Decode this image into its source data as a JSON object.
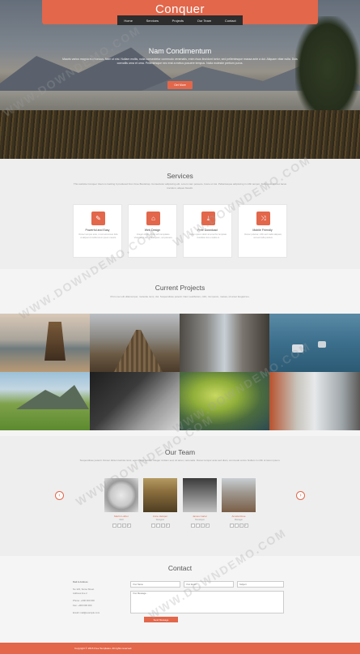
{
  "brand": "Conquer",
  "nav": [
    "Home",
    "Services",
    "Projects",
    "Our Team",
    "Contact"
  ],
  "hero": {
    "title": "Nam Condimentum",
    "text": "Mauris varius magna eu rhoncus. Nam ut nisi. Nullam mollis, nulla consectetur commodo venenatis, enim risus tincidunt tortor, sed pellentesque massa ante a dui. Aliquam vitae nulla. Duis convallis urna et urna. Pellentesque nec erat a metus posuere tempus. Nulla molestie pretium purus.",
    "button": "Get More"
  },
  "services": {
    "title": "Services",
    "subtitle": "This website Conquer Users is Getting It produced from Free Bootstrap. Consectetur adipiscing elit. Lorem nam posuere, fusce ut nisi. Pellentesque adipiscing in nibh tempor. Nulla quis elit nec lacus tincidunt, aliquet blandit.",
    "items": [
      {
        "icon": "edit-icon",
        "glyph": "✎",
        "title": "Powerful and Easy",
        "desc": "Donec tempus ante, ut est accumsan felis ut aliquet id mollis lorem ipsum mauris."
      },
      {
        "icon": "home-icon",
        "glyph": "⌂",
        "title": "Web Design",
        "desc": "Integer et elit et felis with templates. Vivamus ut elit, sed aliquam, vel posuere."
      },
      {
        "icon": "download-icon",
        "glyph": "⤓",
        "title": "Free Download",
        "desc": "Lorem ipsum dolor sit amet for template. Curabitur dui a mattis ut."
      },
      {
        "icon": "shuffle-icon",
        "glyph": "⤨",
        "title": "Mobile Friendly",
        "desc": "Donec pulvinar, nibh sed mattis aliquam, vel sed nulla pretium."
      }
    ]
  },
  "projects": {
    "title": "Current Projects",
    "subtitle": "Proin nec elit ullamcorper, molestie nunc, dui. Suspendisse potenti. Nam vestibulum, nibh, nisi ipsum, massa, sit amet feugiat leo."
  },
  "team": {
    "title": "Our Team",
    "subtitle": "Suspendisse potenti. Donec dictum lacinia nunc, eget. Nulla facilisi. Integer id diam sed, sit amet, venenatis. Donec tempor ante sed diam, commodo at dui. Nullam in nibh ut lorem ipsum.",
    "members": [
      {
        "name": "Martin Luther",
        "role": "CEO"
      },
      {
        "name": "Anne Helsper",
        "role": "Designer"
      },
      {
        "name": "James Carter",
        "role": "Developer"
      },
      {
        "name": "Amelia Rose",
        "role": "Manager"
      }
    ],
    "social": [
      "f",
      "t",
      "g",
      "in"
    ]
  },
  "contact": {
    "title": "Contact",
    "info_heading": "Mail & Address",
    "info_lines": [
      "No 123, Some Street",
      "Address line 2",
      "Phone: +000 000 000",
      "Fax: +000 000 000",
      "Email: mail@example.com"
    ],
    "name_placeholder": "Your Name",
    "email_placeholder": "Your Email",
    "subject_placeholder": "Subject",
    "message_placeholder": "Your Message...",
    "send_button": "Send Message"
  },
  "footer": "Copyright © 2016 Free Templates. All rights reserved.",
  "watermark": "WWW.DOWNDEMO.COM",
  "colors": {
    "accent": "#e2674b",
    "dark_nav": "#2d2d2d"
  }
}
